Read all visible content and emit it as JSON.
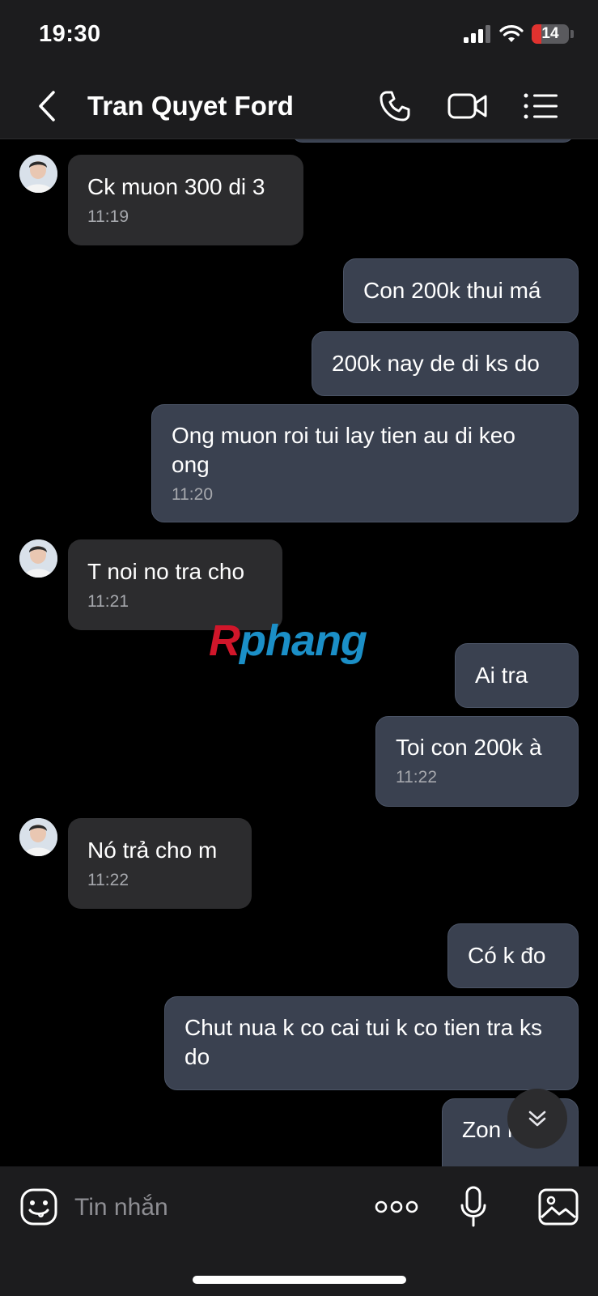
{
  "status_bar": {
    "time": "19:30",
    "battery": "14"
  },
  "header": {
    "title": "Tran Quyet Ford"
  },
  "messages": [
    {
      "dir": "in",
      "text": "Ck muon 300 di 3",
      "time": "11:19"
    },
    {
      "dir": "out",
      "text": "Con 200k thui má",
      "time": ""
    },
    {
      "dir": "out",
      "text": "200k nay de di ks do",
      "time": ""
    },
    {
      "dir": "out",
      "text": "Ong muon roi tui lay tien au di keo ong",
      "time": "11:20"
    },
    {
      "dir": "in",
      "text": "T noi no tra cho",
      "time": "11:21"
    },
    {
      "dir": "out",
      "text": "Ai tra",
      "time": ""
    },
    {
      "dir": "out",
      "text": "Toi con 200k à",
      "time": "11:22"
    },
    {
      "dir": "in",
      "text": "Nó trả cho m",
      "time": "11:22"
    },
    {
      "dir": "out",
      "text": "Có k đo",
      "time": ""
    },
    {
      "dir": "out",
      "text": "Chut nua k co cai tui k co tien tra ks do",
      "time": ""
    },
    {
      "dir": "out",
      "text": "Zon hoai",
      "time": ""
    }
  ],
  "watermark": {
    "part1": "R",
    "part2": "phang"
  },
  "composer": {
    "placeholder": "Tin nhắn"
  },
  "colors": {
    "background": "#000000",
    "bar": "#1c1c1e",
    "incoming": "#2c2c2e",
    "outgoing": "#3a4150",
    "battery_low": "#e0322f"
  }
}
